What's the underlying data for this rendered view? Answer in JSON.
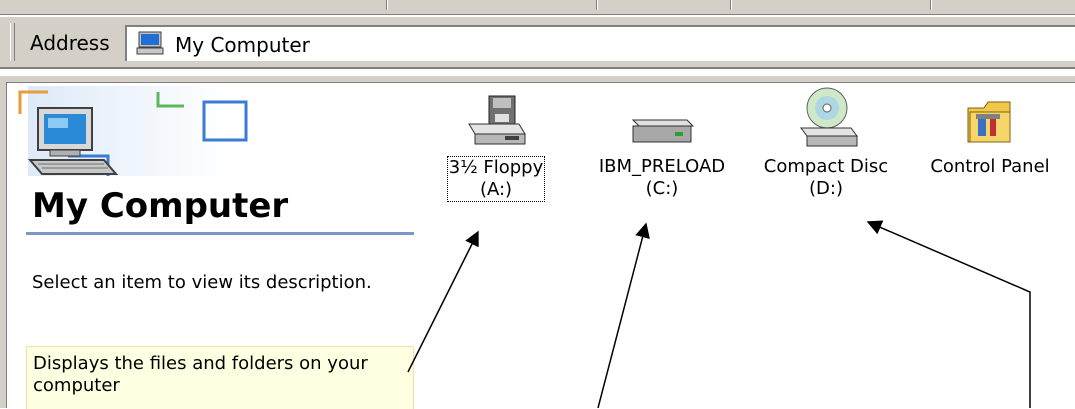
{
  "address": {
    "label": "Address",
    "value": "My Computer",
    "icon": "computer-icon"
  },
  "panel": {
    "title": "My Computer",
    "description": "Select an item to view its description.",
    "tooltip": "Displays the files and folders on your computer"
  },
  "items": [
    {
      "line1": "3½ Floppy",
      "line2": "(A:)",
      "icon": "floppy-drive-icon"
    },
    {
      "line1": "IBM_PRELOAD",
      "line2": "(C:)",
      "icon": "hard-drive-icon"
    },
    {
      "line1": "Compact Disc",
      "line2": "(D:)",
      "icon": "cd-drive-icon"
    },
    {
      "line1": "Control Panel",
      "line2": "",
      "icon": "control-panel-icon"
    }
  ]
}
